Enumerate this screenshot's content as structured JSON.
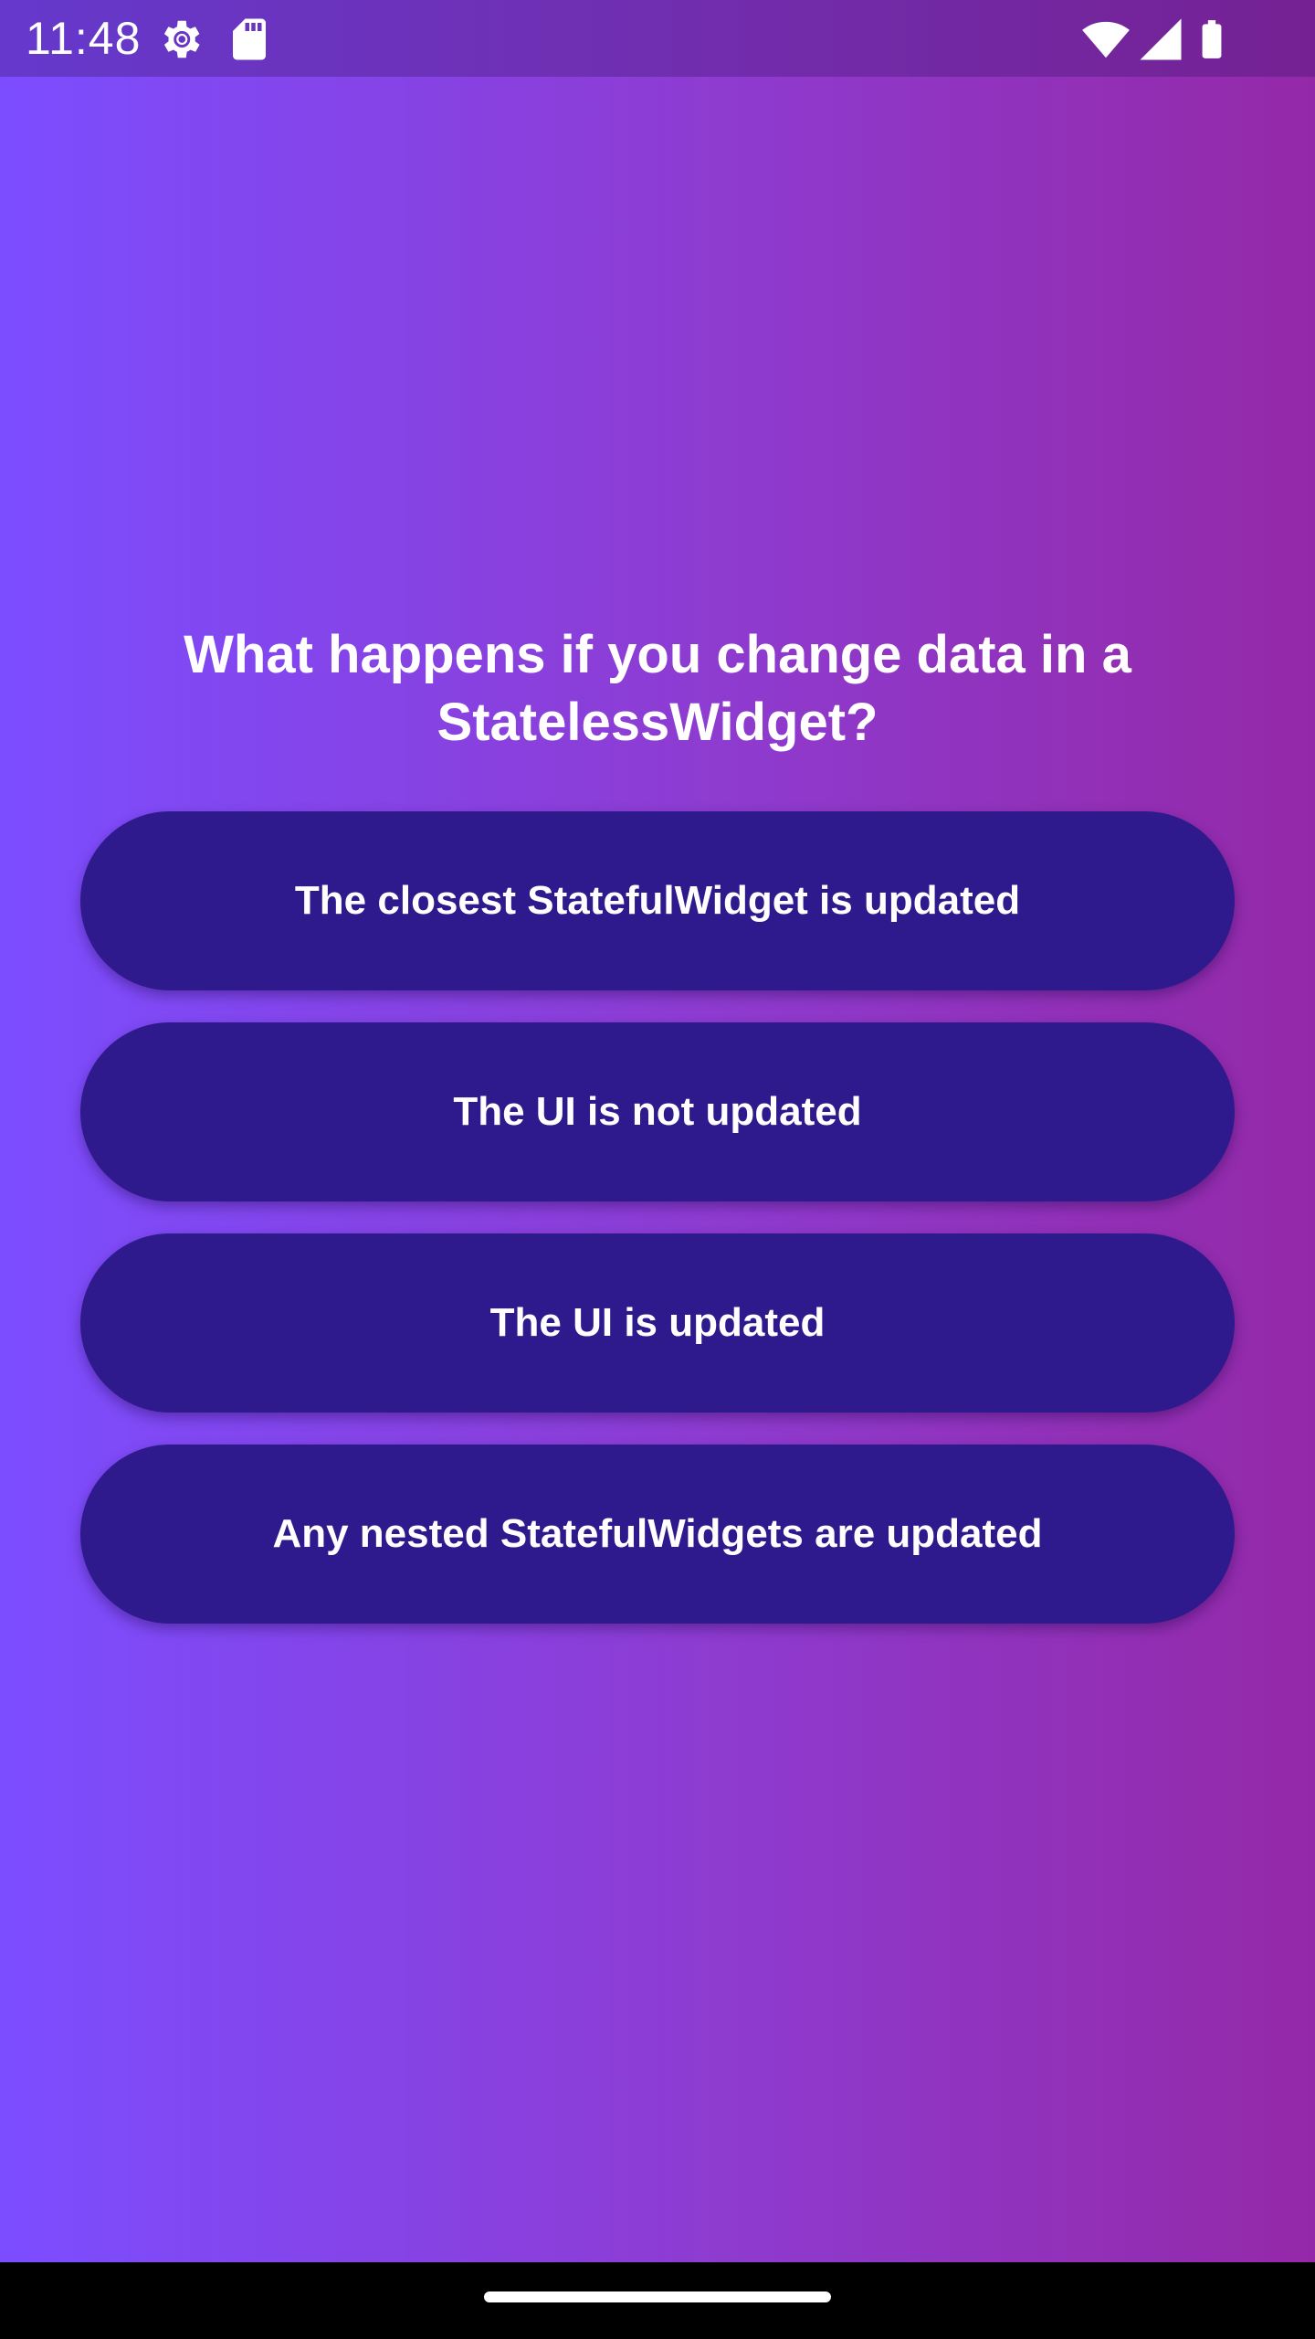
{
  "status_bar": {
    "time": "11:48",
    "icons": [
      "settings-gear-icon",
      "sd-card-icon",
      "wifi-icon",
      "cellular-signal-icon",
      "battery-icon"
    ]
  },
  "quiz": {
    "question": "What happens if you change data in a StatelessWidget?",
    "answers": [
      "The closest StatefulWidget is updated",
      "The UI is not updated",
      "The UI is updated",
      "Any nested StatefulWidgets are updated"
    ]
  },
  "colors": {
    "gradient_start": "#7c4dff",
    "gradient_end": "#9429a8",
    "button_background": "#2e1a8c",
    "text": "#ffffff"
  }
}
